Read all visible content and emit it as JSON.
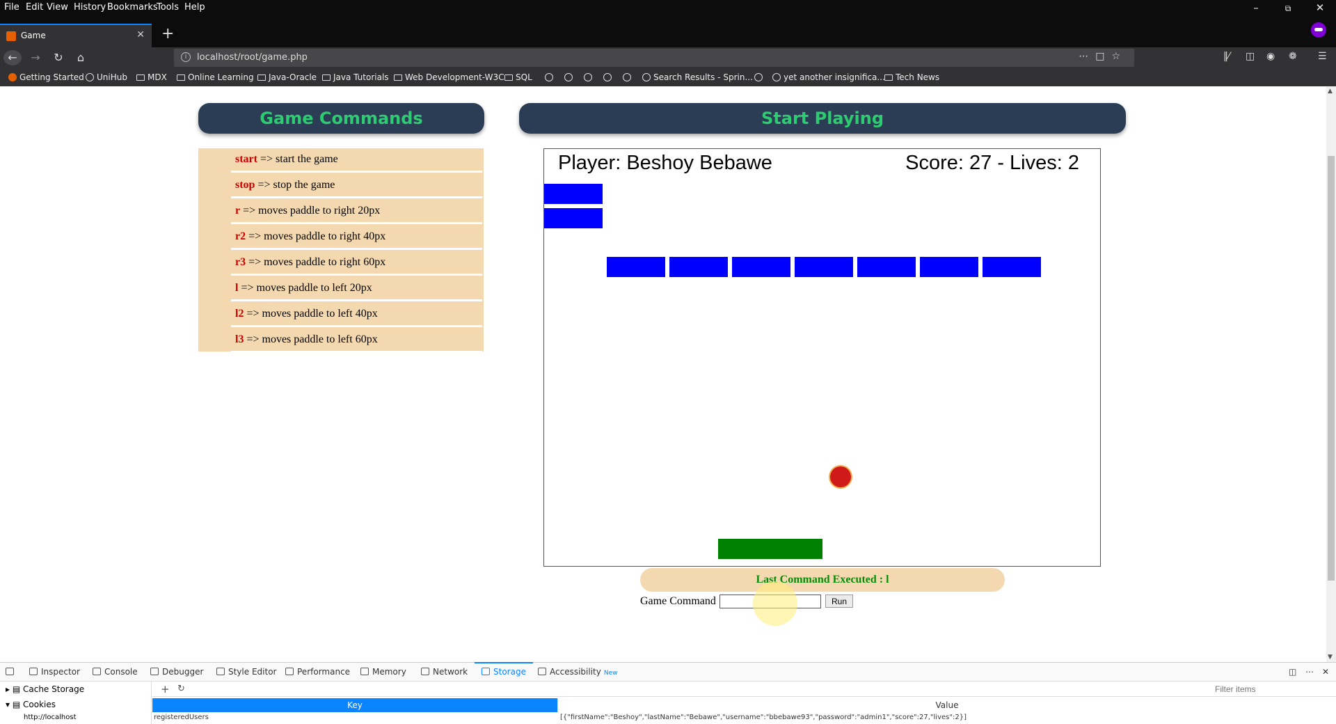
{
  "browser": {
    "menu": [
      "File",
      "Edit",
      "View",
      "History",
      "Bookmarks",
      "Tools",
      "Help"
    ],
    "tab_title": "Game",
    "url": "localhost/root/game.php",
    "bookmarks": [
      "Getting Started",
      "UniHub",
      "MDX",
      "Online Learning",
      "Java-Oracle",
      "Java Tutorials",
      "Web Development-W3C",
      "SQL",
      "Search Results - Sprin...",
      "yet another insignifica...",
      "Tech News"
    ]
  },
  "commands": {
    "header": "Game Commands",
    "items": [
      {
        "key": "start",
        "desc": " => start the game"
      },
      {
        "key": "stop",
        "desc": " => stop the game"
      },
      {
        "key": "r",
        "desc": " => moves paddle to right 20px"
      },
      {
        "key": "r2",
        "desc": " => moves paddle to right 40px"
      },
      {
        "key": "r3",
        "desc": " => moves paddle to right 60px"
      },
      {
        "key": "l",
        "desc": " => moves paddle to left 20px"
      },
      {
        "key": "l2",
        "desc": " => moves paddle to left 40px"
      },
      {
        "key": "l3",
        "desc": " => moves paddle to left 60px"
      }
    ]
  },
  "game": {
    "header": "Start Playing",
    "player": "Player: Beshoy Bebawe",
    "score": "Score: 27 - Lives: 2",
    "colors": {
      "brick": "#0000ff",
      "ball": "#d01a1a",
      "paddle": "#008000"
    }
  },
  "form": {
    "last_command": "Last Command Executed : l",
    "label": "Game Command",
    "input_value": "",
    "run_label": "Run"
  },
  "devtools": {
    "tabs": [
      "Inspector",
      "Console",
      "Debugger",
      "Style Editor",
      "Performance",
      "Memory",
      "Network",
      "Storage",
      "Accessibility"
    ],
    "new_badge": "New",
    "tree": [
      "Cache Storage",
      "Cookies",
      "http://localhost"
    ],
    "filter_placeholder": "Filter items",
    "columns": {
      "key": "Key",
      "value": "Value"
    },
    "row": {
      "key": "registeredUsers",
      "value": "[{\"firstName\":\"Beshoy\",\"lastName\":\"Bebawe\",\"username\":\"bbebawe93\",\"password\":\"admin1\",\"score\":27,\"lives\":2}]"
    }
  }
}
